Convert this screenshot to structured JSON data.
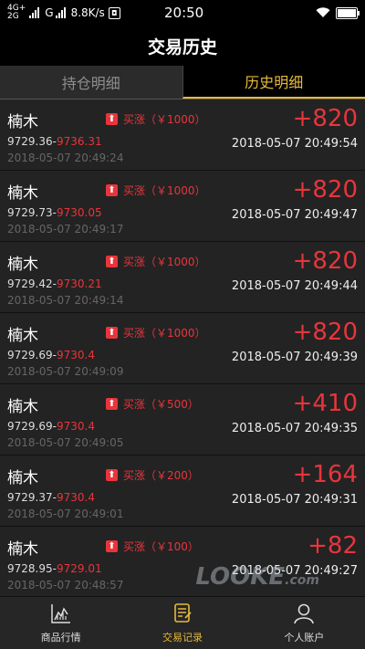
{
  "status_bar": {
    "net_top": "4G+",
    "net_bottom": "2G",
    "carrier_g": "G",
    "speed": "8.8K/s",
    "time": "20:50",
    "battery_level": 1.0
  },
  "title": "交易历史",
  "tabs": [
    {
      "label": "持仓明细",
      "active": false
    },
    {
      "label": "历史明细",
      "active": true
    }
  ],
  "trades": [
    {
      "name": "楠木",
      "tag": "买涨（￥1000）",
      "open": "9729.36",
      "close": "9736.31",
      "open_time": "2018-05-07 20:49:24",
      "profit": "+820",
      "close_time": "2018-05-07 20:49:54"
    },
    {
      "name": "楠木",
      "tag": "买涨（￥1000）",
      "open": "9729.73",
      "close": "9730.05",
      "open_time": "2018-05-07 20:49:17",
      "profit": "+820",
      "close_time": "2018-05-07 20:49:47"
    },
    {
      "name": "楠木",
      "tag": "买涨（￥1000）",
      "open": "9729.42",
      "close": "9730.21",
      "open_time": "2018-05-07 20:49:14",
      "profit": "+820",
      "close_time": "2018-05-07 20:49:44"
    },
    {
      "name": "楠木",
      "tag": "买涨（￥1000）",
      "open": "9729.69",
      "close": "9730.4",
      "open_time": "2018-05-07 20:49:09",
      "profit": "+820",
      "close_time": "2018-05-07 20:49:39"
    },
    {
      "name": "楠木",
      "tag": "买涨（￥500）",
      "open": "9729.69",
      "close": "9730.4",
      "open_time": "2018-05-07 20:49:05",
      "profit": "+410",
      "close_time": "2018-05-07 20:49:35"
    },
    {
      "name": "楠木",
      "tag": "买涨（￥200）",
      "open": "9729.37",
      "close": "9730.4",
      "open_time": "2018-05-07 20:49:01",
      "profit": "+164",
      "close_time": "2018-05-07 20:49:31"
    },
    {
      "name": "楠木",
      "tag": "买涨（￥100）",
      "open": "9728.95",
      "close": "9729.01",
      "open_time": "2018-05-07 20:48:57",
      "profit": "+82",
      "close_time": "2018-05-07 20:49:27"
    }
  ],
  "bottom_nav": [
    {
      "label": "商品行情",
      "icon": "chart-icon",
      "active": false
    },
    {
      "label": "交易记录",
      "icon": "record-icon",
      "active": true
    },
    {
      "label": "个人账户",
      "icon": "user-icon",
      "active": false
    }
  ],
  "watermark": "LOOKE.com",
  "colors": {
    "accent": "#e6b93a",
    "up": "#e8353b",
    "background": "#1e1e1e"
  }
}
